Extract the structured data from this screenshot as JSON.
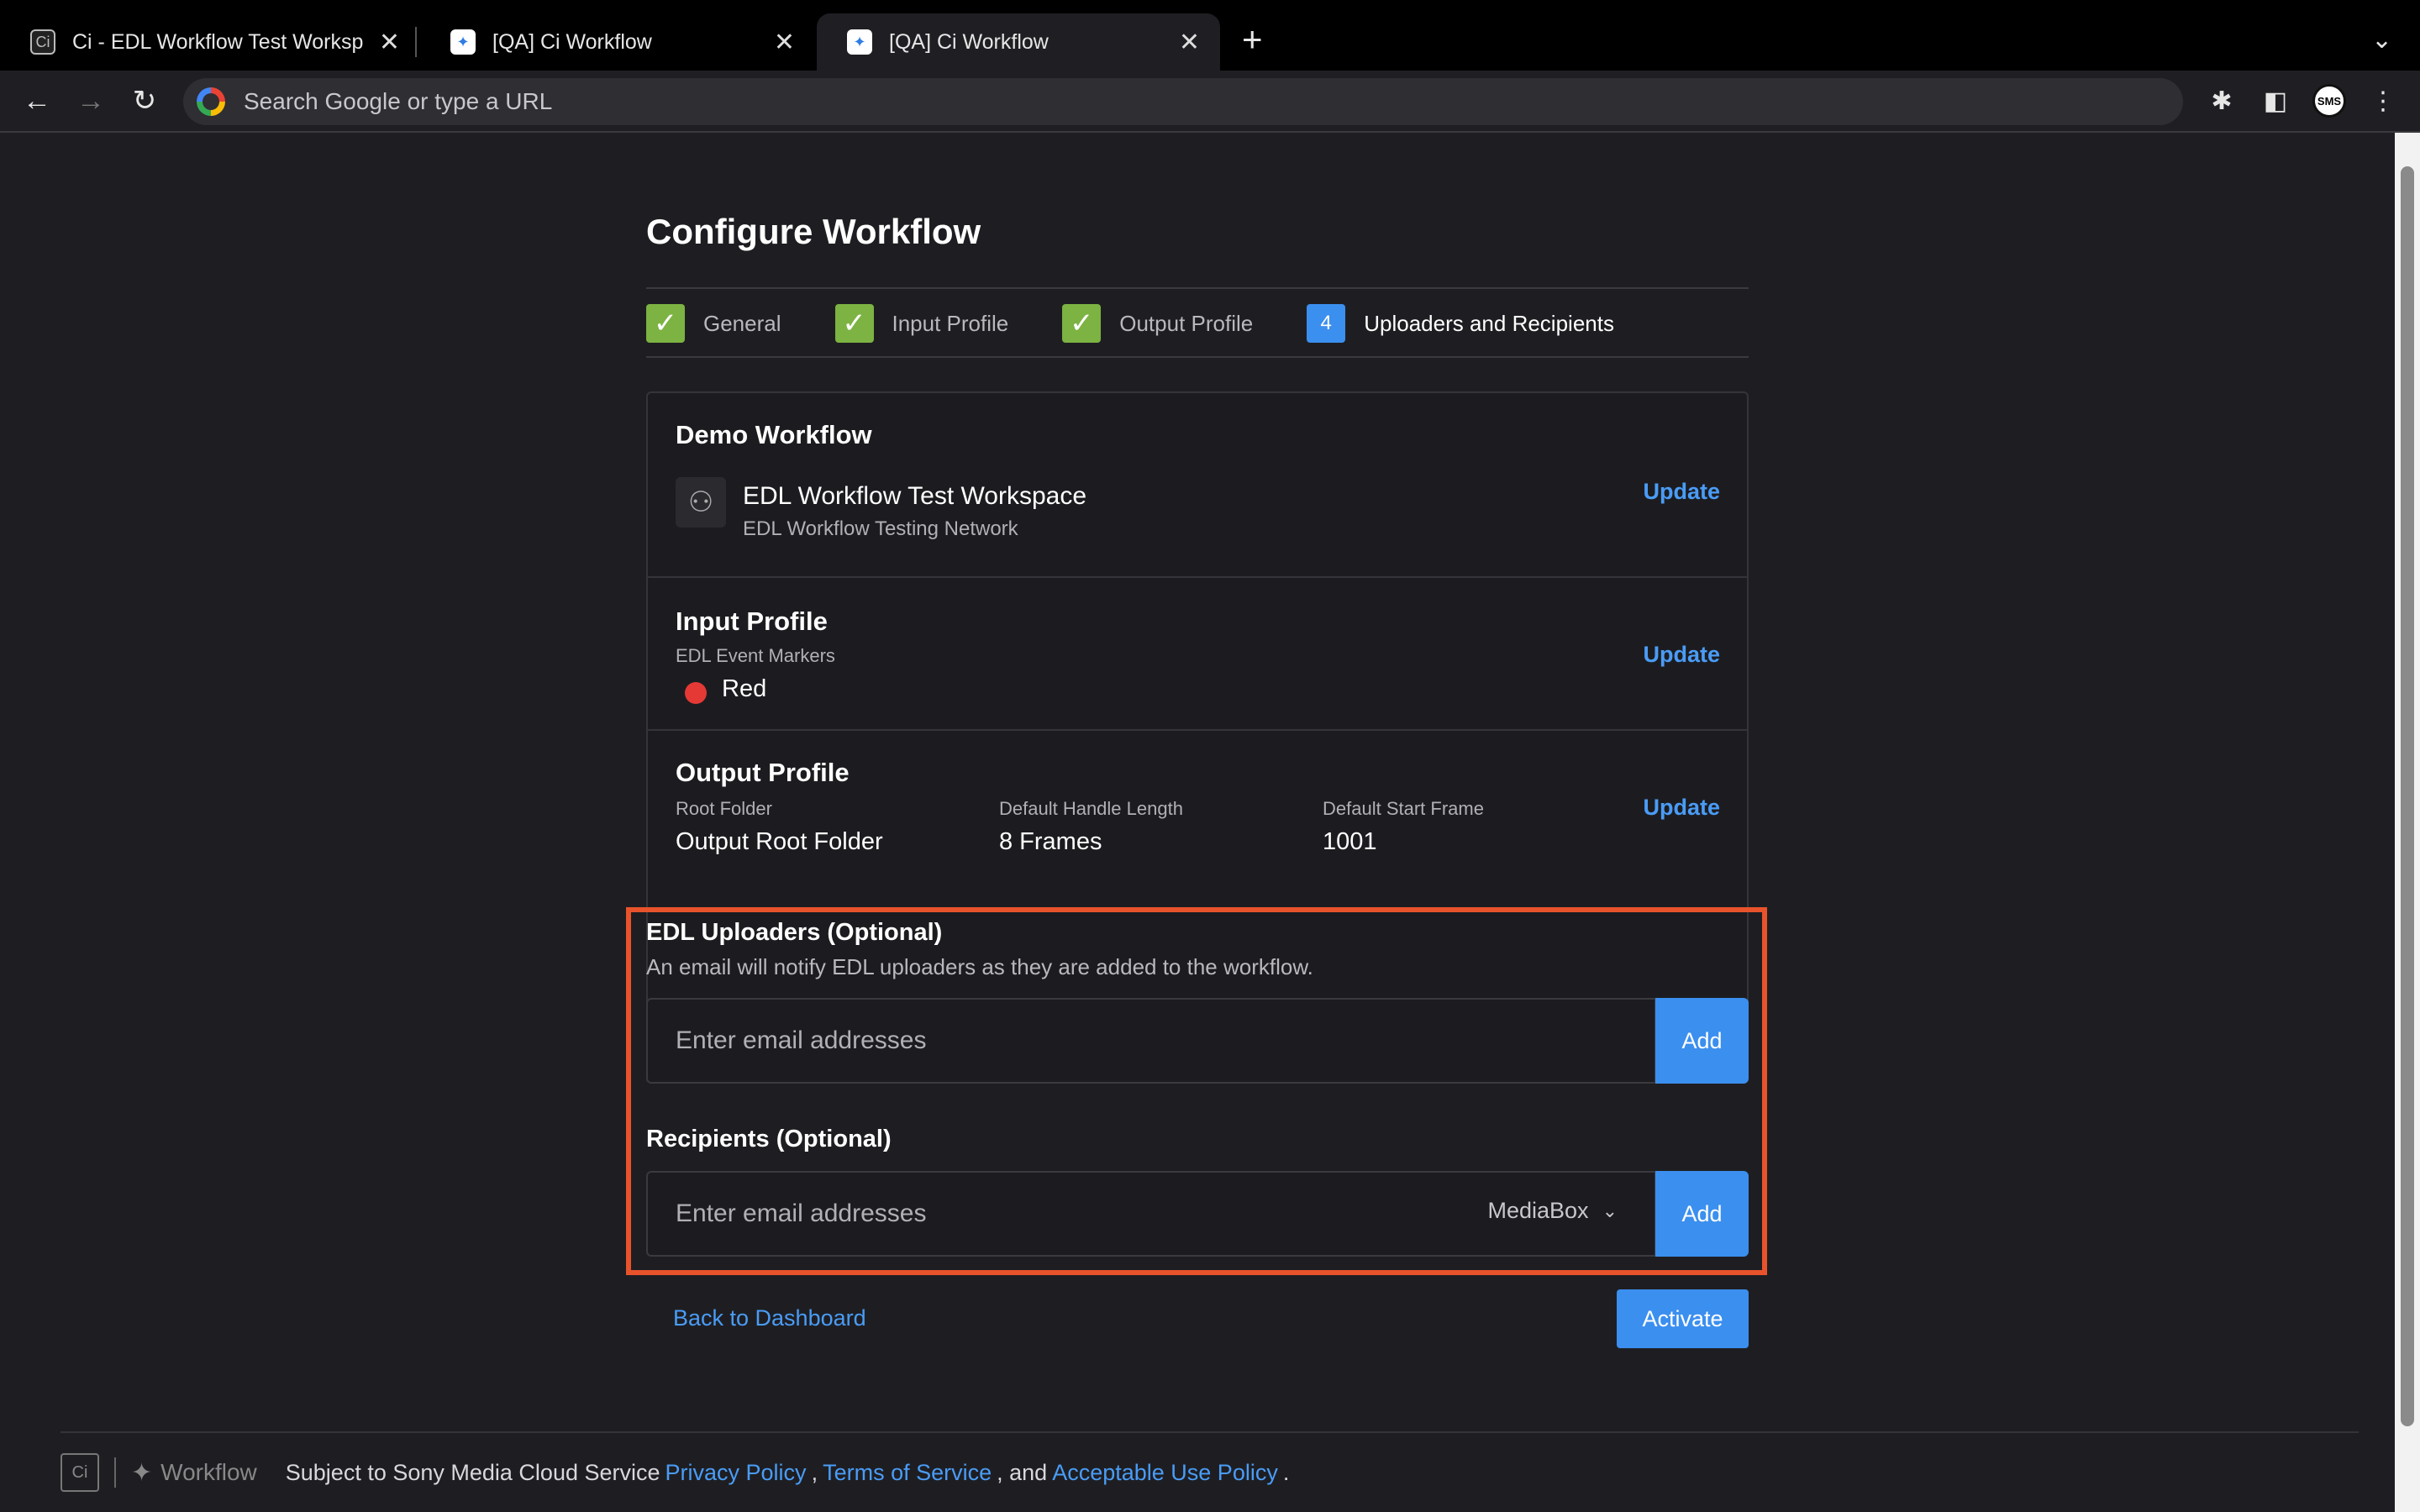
{
  "browser": {
    "tabs": [
      {
        "title": "Ci - EDL Workflow Test Worksp",
        "favicon": "ci-logo-icon"
      },
      {
        "title": "[QA] Ci Workflow",
        "favicon": "workflow-icon"
      },
      {
        "title": "[QA] Ci Workflow",
        "favicon": "workflow-icon"
      }
    ],
    "omnibox_placeholder": "Search Google or type a URL",
    "profile_initials": "SMS"
  },
  "page": {
    "title": "Configure Workflow",
    "steps": [
      {
        "label": "General",
        "status": "complete"
      },
      {
        "label": "Input Profile",
        "status": "complete"
      },
      {
        "label": "Output Profile",
        "status": "complete"
      },
      {
        "label": "Uploaders and Recipients",
        "status": "current",
        "number": "4"
      }
    ],
    "workflow": {
      "name": "Demo Workflow",
      "workspace_name": "EDL Workflow Test Workspace",
      "network_name": "EDL Workflow Testing Network",
      "update_label": "Update"
    },
    "input_profile": {
      "title": "Input Profile",
      "markers_label": "EDL Event Markers",
      "marker_color_name": "Red",
      "marker_color": "#e53935",
      "update_label": "Update"
    },
    "output_profile": {
      "title": "Output Profile",
      "root_folder_label": "Root Folder",
      "root_folder_value": "Output Root Folder",
      "handle_label": "Default Handle Length",
      "handle_value": "8 Frames",
      "start_frame_label": "Default Start Frame",
      "start_frame_value": "1001",
      "update_label": "Update"
    },
    "uploaders": {
      "title": "EDL Uploaders (Optional)",
      "description": "An email will notify EDL uploaders as they are added to the workflow.",
      "placeholder": "Enter email addresses",
      "add_label": "Add"
    },
    "recipients": {
      "title": "Recipients (Optional)",
      "placeholder": "Enter email addresses",
      "destination": "MediaBox",
      "add_label": "Add"
    },
    "back_label": "Back to Dashboard",
    "activate_label": "Activate"
  },
  "footer": {
    "brand": "Workflow",
    "prefix": "Subject to Sony Media Cloud Service",
    "privacy": "Privacy Policy",
    "sep1": ",",
    "terms": "Terms of Service",
    "sep2": ", and",
    "aup": "Acceptable Use Policy",
    "suffix": "."
  },
  "colors": {
    "accent": "#3b8fef",
    "link": "#4a9cf6",
    "complete": "#7cb342",
    "highlight": "#e8532c"
  }
}
